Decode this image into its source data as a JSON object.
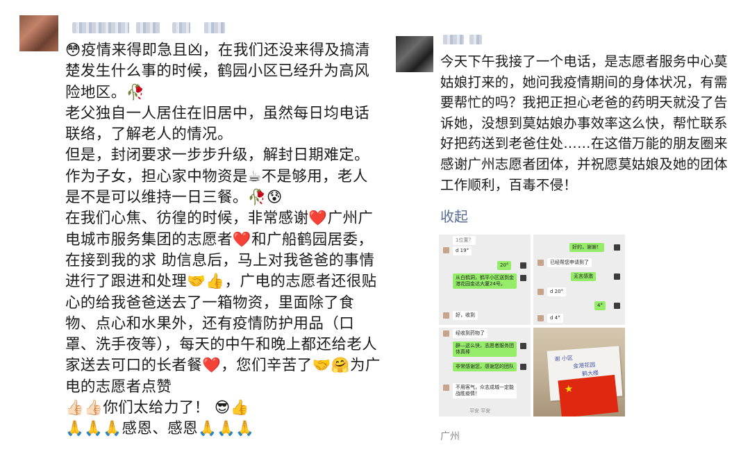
{
  "left_post": {
    "emoji": {
      "flushed": "😳",
      "wilted_flower": "🥀",
      "hot_beverage": "☕",
      "cold_sweat": "😰",
      "red_heart": "❤️",
      "handshake": "🤝",
      "thumbs_up": "👍",
      "hugging": "🤗",
      "thumbs_up_light": "👍🏻👍🏻",
      "sunglasses": "😎",
      "prayer": "🙏🙏🙏"
    },
    "line1": "疫情来得即急且凶，在我们还没来得及搞清楚发生什么事的时候，鹤园小区已经升为高风险地区。",
    "line2": "老父独自一人居住在旧居中，虽然每日均电话联络，了解老人的情况。",
    "line3": "但是，封闭要求一步步升级，解封日期难定。",
    "line4a": "作为子女，担心家中物资是",
    "line4b": "不是够用，老人是不是可以维持一日三餐。",
    "line5a": "在我们心焦、彷徨的时候，非常感谢",
    "line5b": "广州广电城市服务集团的志愿者",
    "line5c": "和广船鹤园居委，在接到我的求 助信息后，马上对我爸爸的事情进行了跟进和处理",
    "line5d": "，广电的志愿者还很贴心的给我爸爸送去了一箱物资，里面除了食物、点心和水果外，还有疫情防护用品（口罩、洗手夜等），每天的中午和晚上都还给老人家送去可口的长者餐",
    "line5e": "，您们辛苦了",
    "line5f": "为广电的志愿者点赞",
    "line6": "你们太给力了！",
    "line7": "感恩、感恩"
  },
  "right_post": {
    "body": "今天下午我接了一个电话，是志愿者服务中心莫姑娘打来的，她问我疫情期间的身体状况，有需要帮忙的吗？我把正担心老爸的药明天就没了告诉她，没想到莫姑娘办事效率这么快，帮忙联系好把药送到老爸住处……在这借万能的朋友圈来感谢广州志愿者团体，并祝愿莫姑娘及她的团体工作顺利，百毒不侵！",
    "collapse_label": "收起",
    "location": "广州",
    "colors": {
      "link": "#576b95",
      "location": "#8a8a8a"
    },
    "images": {
      "chat1": {
        "msg1": "1位置？",
        "msg2": "d 19°",
        "msg3": "20°",
        "msg4": "从白鹤洞，鹤平小区送到金港花园金达大厦24号。",
        "msg5": "好，收到"
      },
      "chat2": {
        "msg1": "好的，谢谢！",
        "msg2": "已经帮您申请到了",
        "msg3": "无言感激",
        "msg4": "d 20°",
        "msg5": "4°",
        "msg6": "d 4°"
      },
      "chat3": {
        "msg1": "经收到药物了",
        "msg2": "辟—这么快，志愿者服务团体真棒",
        "msg3": "非常感谢您，感谢您的团队",
        "msg4": "不用客气，众志成城一定能战胜疫情！",
        "msg5": "平安 平安"
      },
      "photo": {
        "note1": "谢 小区",
        "note2": "金港花园",
        "note3": "鹤大楼",
        "flag_star": "★"
      }
    }
  }
}
